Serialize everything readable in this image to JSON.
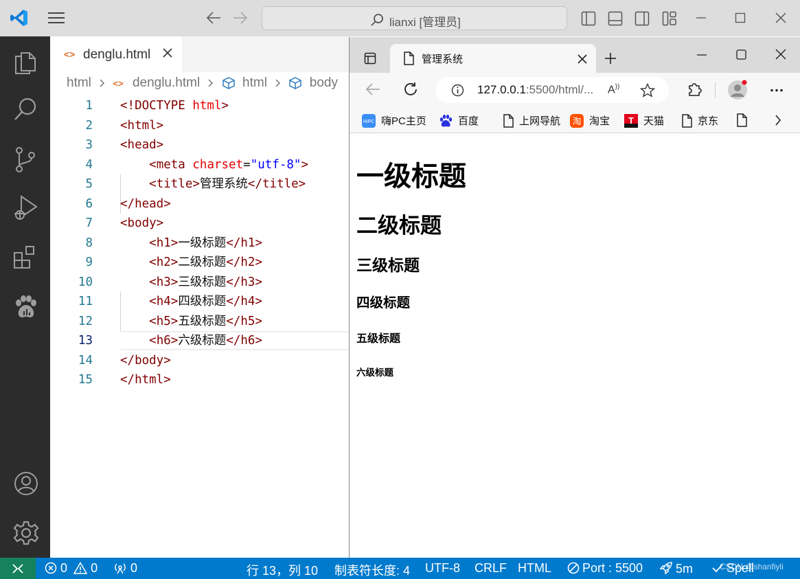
{
  "vscode": {
    "command_center": "lianxi [管理员]",
    "tab": {
      "filename": "denglu.html"
    },
    "breadcrumbs": [
      "html",
      "denglu.html",
      "html",
      "body"
    ],
    "code_lines": [
      {
        "n": "1",
        "tokens": [
          [
            "t",
            "<!DOCTYPE "
          ],
          [
            "a",
            "html"
          ],
          [
            "t",
            ">"
          ]
        ]
      },
      {
        "n": "2",
        "tokens": [
          [
            "t",
            "<html>"
          ]
        ]
      },
      {
        "n": "3",
        "tokens": [
          [
            "t",
            "<head>"
          ]
        ]
      },
      {
        "n": "4",
        "tokens": [
          [
            "x",
            "    "
          ],
          [
            "t",
            "<meta "
          ],
          [
            "a",
            "charset"
          ],
          [
            "x",
            "="
          ],
          [
            "v",
            "\"utf-8\""
          ],
          [
            "t",
            ">"
          ]
        ]
      },
      {
        "n": "5",
        "tokens": [
          [
            "x",
            "    "
          ],
          [
            "t",
            "<title>"
          ],
          [
            "x",
            "管理系统"
          ],
          [
            "t",
            "</title>"
          ]
        ]
      },
      {
        "n": "6",
        "tokens": [
          [
            "t",
            "</head>"
          ]
        ]
      },
      {
        "n": "7",
        "tokens": [
          [
            "t",
            "<body>"
          ]
        ]
      },
      {
        "n": "8",
        "tokens": [
          [
            "x",
            "    "
          ],
          [
            "t",
            "<h1>"
          ],
          [
            "x",
            "一级标题"
          ],
          [
            "t",
            "</h1>"
          ]
        ]
      },
      {
        "n": "9",
        "tokens": [
          [
            "x",
            "    "
          ],
          [
            "t",
            "<h2>"
          ],
          [
            "x",
            "二级标题"
          ],
          [
            "t",
            "</h2>"
          ]
        ]
      },
      {
        "n": "10",
        "tokens": [
          [
            "x",
            "    "
          ],
          [
            "t",
            "<h3>"
          ],
          [
            "x",
            "三级标题"
          ],
          [
            "t",
            "</h3>"
          ]
        ]
      },
      {
        "n": "11",
        "tokens": [
          [
            "x",
            "    "
          ],
          [
            "t",
            "<h4>"
          ],
          [
            "x",
            "四级标题"
          ],
          [
            "t",
            "</h4>"
          ]
        ]
      },
      {
        "n": "12",
        "tokens": [
          [
            "x",
            "    "
          ],
          [
            "t",
            "<h5>"
          ],
          [
            "x",
            "五级标题"
          ],
          [
            "t",
            "</h5>"
          ]
        ]
      },
      {
        "n": "13",
        "tokens": [
          [
            "x",
            "    "
          ],
          [
            "t",
            "<h6>"
          ],
          [
            "x",
            "六级标题"
          ],
          [
            "t",
            "</h6>"
          ]
        ]
      },
      {
        "n": "14",
        "tokens": [
          [
            "t",
            "</body>"
          ]
        ]
      },
      {
        "n": "15",
        "tokens": [
          [
            "t",
            "</html>"
          ]
        ]
      }
    ],
    "current_line": "13",
    "colors": {
      "tag": "#800000",
      "attr": "#e50000",
      "value": "#0000ff",
      "statusbar": "#007acc",
      "remote": "#16825d"
    }
  },
  "statusbar": {
    "errors": "0",
    "warnings": "0",
    "ports": "0",
    "position": "行 13，列 10",
    "tab_size": "制表符长度: 4",
    "encoding": "UTF-8",
    "eol": "CRLF",
    "language": "HTML",
    "port": "Port : 5500",
    "time": "5m",
    "spell": "Spell"
  },
  "browser": {
    "tab_title": "管理系统",
    "url_host": "127.0.0.1",
    "url_rest": ":5500/html/...",
    "favorites": [
      {
        "label": "嗨PC主页",
        "icon": "hipc-icon"
      },
      {
        "label": "百度",
        "icon": "baidu-paw-icon"
      },
      {
        "label": "上网导航",
        "icon": "page-icon"
      },
      {
        "label": "淘宝",
        "icon": "taobao-icon"
      },
      {
        "label": "天猫",
        "icon": "tmall-icon"
      },
      {
        "label": "京东",
        "icon": "page-icon"
      }
    ],
    "headings": [
      "一级标题",
      "二级标题",
      "三级标题",
      "四级标题",
      "五级标题",
      "六级标题"
    ]
  },
  "watermark": "CSDN @shanfiyli"
}
